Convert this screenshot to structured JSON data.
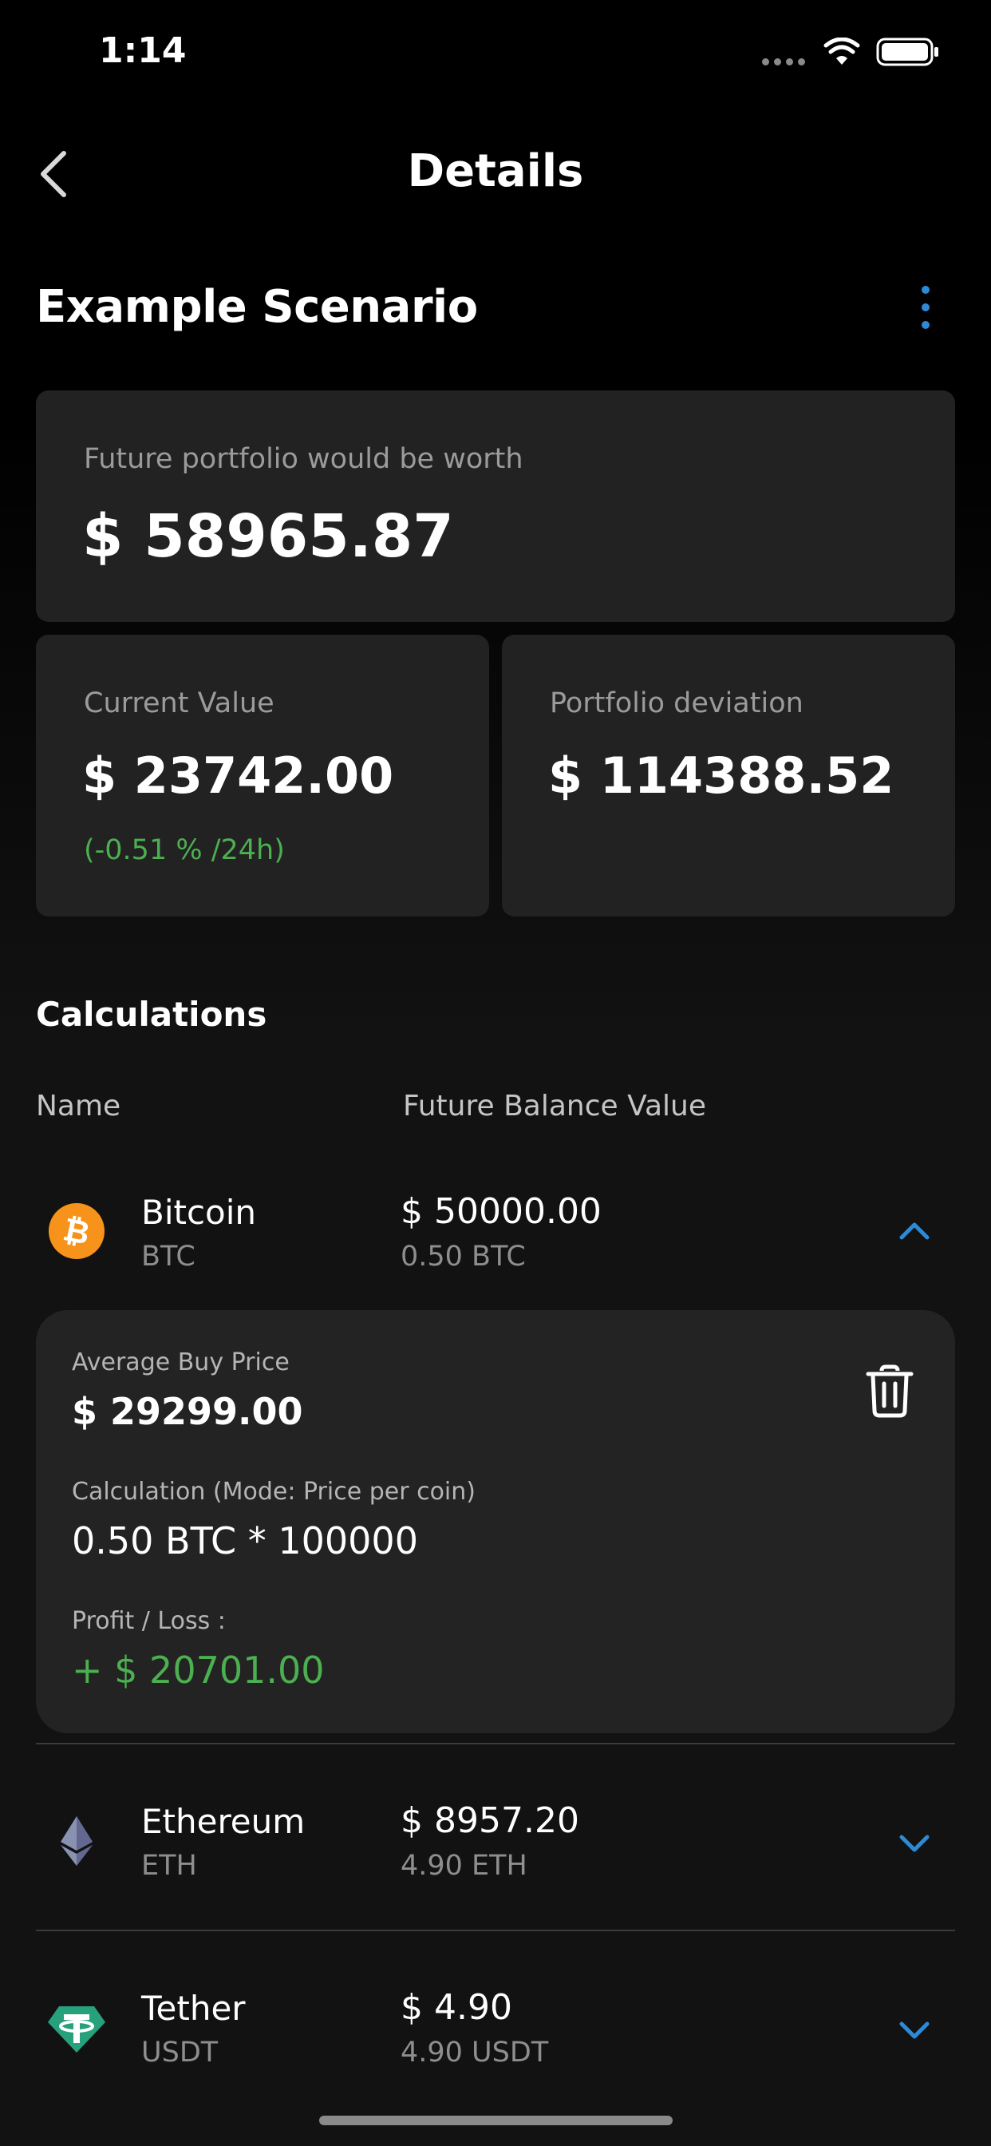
{
  "status_bar": {
    "time": "1:14"
  },
  "nav": {
    "title": "Details"
  },
  "scenario": {
    "title": "Example Scenario"
  },
  "summary": {
    "future_label": "Future portfolio would be worth",
    "future_value": "$ 58965.87",
    "current_label": "Current Value",
    "current_value": "$ 23742.00",
    "current_change": "(-0.51 % /24h)",
    "deviation_label": "Portfolio deviation",
    "deviation_value": "$ 114388.52"
  },
  "calculations": {
    "title": "Calculations",
    "col_name": "Name",
    "col_future": "Future Balance Value",
    "coins": [
      {
        "name": "Bitcoin",
        "symbol": "BTC",
        "value": "$ 50000.00",
        "amount": "0.50 BTC",
        "icon": "bitcoin-icon",
        "expanded": true
      },
      {
        "name": "Ethereum",
        "symbol": "ETH",
        "value": "$ 8957.20",
        "amount": "4.90 ETH",
        "icon": "ethereum-icon",
        "expanded": false
      },
      {
        "name": "Tether",
        "symbol": "USDT",
        "value": "$ 4.90",
        "amount": "4.90 USDT",
        "icon": "tether-icon",
        "expanded": false
      }
    ],
    "detail": {
      "avg_label": "Average Buy Price",
      "avg_value": "$ 29299.00",
      "calc_label": "Calculation (Mode: Price per coin)",
      "calc_value": "0.50 BTC * 100000",
      "pl_label": "Profit / Loss :",
      "pl_value": "+ $ 20701.00"
    }
  },
  "colors": {
    "background": "#121212",
    "card": "#222222",
    "accent": "#2e8ad6",
    "positive": "#4caf50",
    "bitcoin": "#f7931a",
    "tether": "#26a17b"
  }
}
